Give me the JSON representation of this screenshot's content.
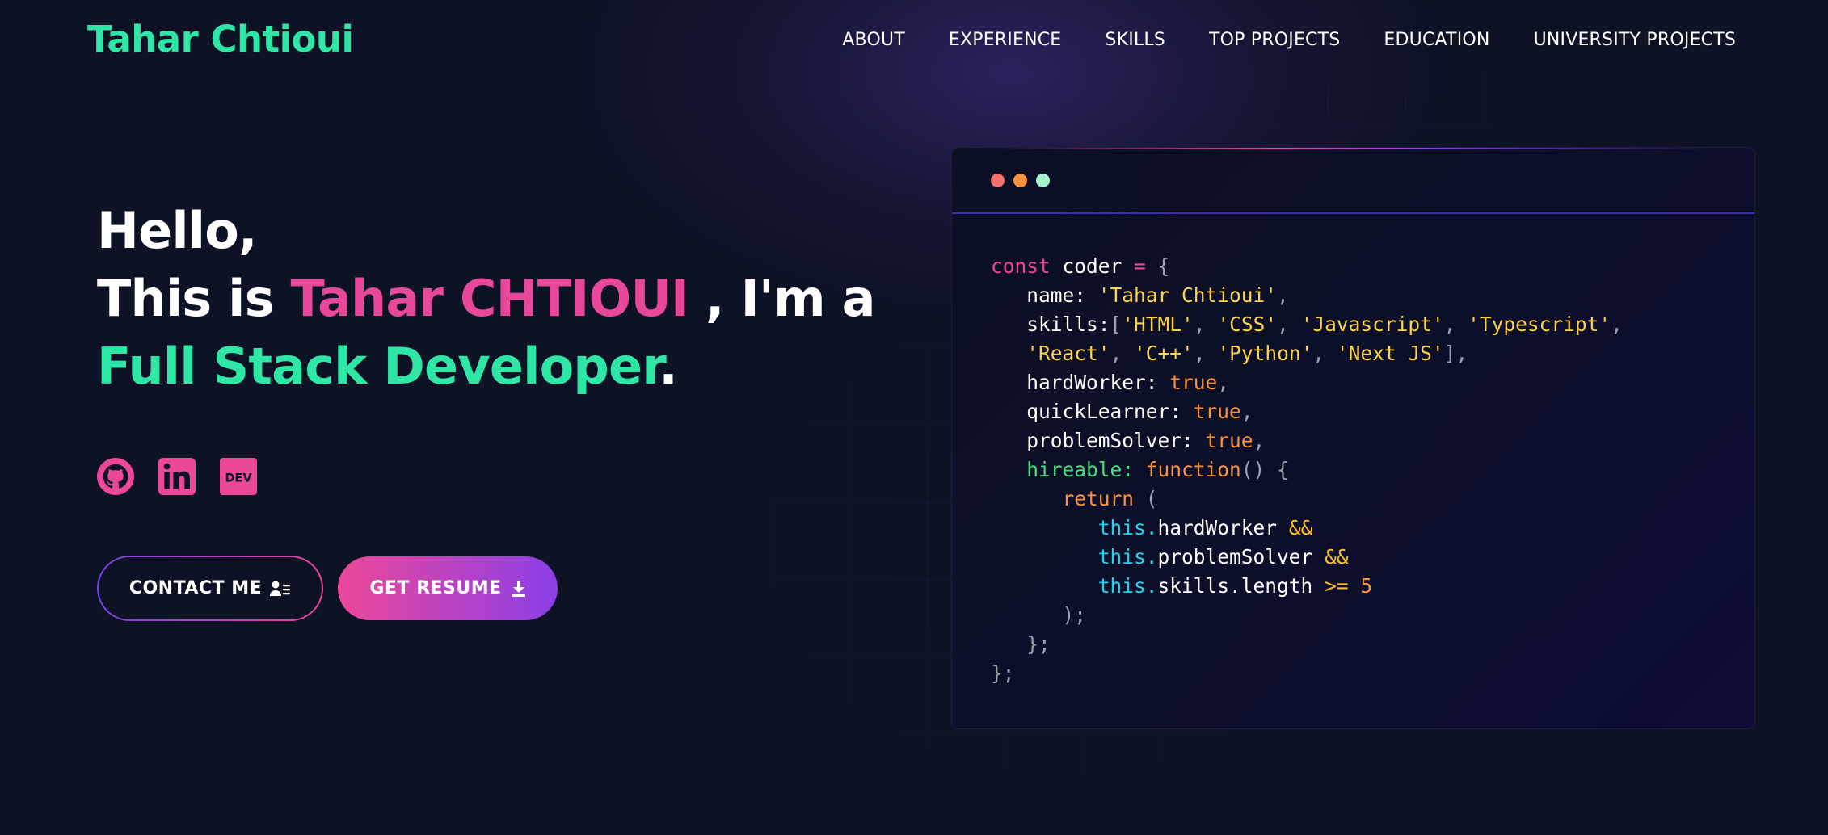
{
  "brand": "Tahar Chtioui",
  "nav": {
    "items": [
      "ABOUT",
      "EXPERIENCE",
      "SKILLS",
      "TOP PROJECTS",
      "EDUCATION",
      "UNIVERSITY PROJECTS"
    ]
  },
  "hero": {
    "line1": "Hello,",
    "line2_prefix": "This is ",
    "name": "Tahar CHTIOUI",
    "line2_suffix": " , I'm a",
    "role": "Full Stack Developer",
    "period": "."
  },
  "socials": [
    "github-icon",
    "linkedin-icon",
    "dev-icon"
  ],
  "social_dev_text": "DEV",
  "buttons": {
    "contact_label": "CONTACT ME",
    "resume_label": "GET RESUME"
  },
  "code": {
    "const_kw": "const",
    "var_name": " coder ",
    "eq": "=",
    "open": " {",
    "name_key": "name: ",
    "name_val": "'Tahar Chtioui'",
    "skills_key": "skills:",
    "skills_line1": [
      "'HTML'",
      "'CSS'",
      "'Javascript'",
      "'Typescript'"
    ],
    "skills_line2": [
      "'React'",
      "'C++'",
      "'Python'",
      "'Next JS'"
    ],
    "hardWorker_key": "hardWorker: ",
    "quickLearner_key": "quickLearner: ",
    "problemSolver_key": "problemSolver: ",
    "true_val": "true",
    "hireable_key": "hireable: ",
    "function_kw": "function",
    "return_kw": "return",
    "this_kw": "this.",
    "cond1": "hardWorker",
    "cond2": "problemSolver",
    "cond3": "skills.length",
    "and_op": "&&",
    "gte_op": ">=",
    "num": "5"
  },
  "colors": {
    "brand": "#2ee6a6",
    "accent_pink": "#e8489a",
    "accent_purple": "#8b3ee8",
    "background": "#0d1224"
  }
}
